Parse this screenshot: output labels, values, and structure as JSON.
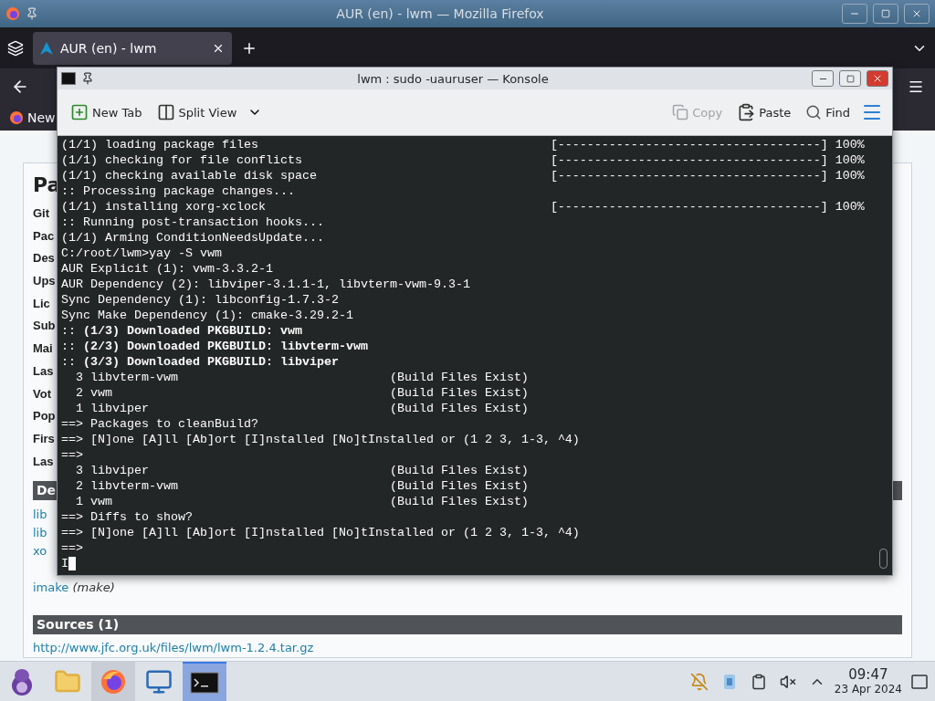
{
  "firefox": {
    "title": "AUR (en) - lwm — Mozilla Firefox",
    "tabs": [
      {
        "label": "AUR (en) - lwm",
        "selected": true
      }
    ],
    "bookmarks": [
      {
        "label": "New"
      }
    ],
    "page": {
      "heading": "Pa",
      "fields": [
        "Git",
        "Pac",
        "Des",
        "Ups",
        "Lic",
        "Sub",
        "Mai",
        "Las",
        "Vot",
        "Pop",
        "Firs",
        "Las"
      ],
      "dependencies_header": "De",
      "dependencies": [
        {
          "name": "lib"
        },
        {
          "name": "lib"
        },
        {
          "name": "xo"
        },
        {
          "name": "imake",
          "note": "(make)"
        }
      ],
      "sources_header": "Sources (1)",
      "sources": [
        "http://www.jfc.org.uk/files/lwm/lwm-1.2.4.tar.gz"
      ]
    }
  },
  "konsole": {
    "title": "lwm : sudo -uauruser — Konsole",
    "toolbar_left": [
      {
        "label": "New Tab",
        "kind": "newtab",
        "disabled": false
      },
      {
        "label": "Split View",
        "kind": "split",
        "disabled": false
      }
    ],
    "toolbar_right": [
      {
        "label": "Copy",
        "kind": "copy",
        "disabled": true
      },
      {
        "label": "Paste",
        "kind": "paste",
        "disabled": false
      },
      {
        "label": "Find",
        "kind": "find",
        "disabled": false
      }
    ],
    "lines": [
      {
        "kind": "progress",
        "text": "(1/1) loading package files",
        "bar": "[------------------------------------]",
        "percent": "100%"
      },
      {
        "kind": "progress",
        "text": "(1/1) checking for file conflicts",
        "bar": "[------------------------------------]",
        "percent": "100%"
      },
      {
        "kind": "progress",
        "text": "(1/1) checking available disk space",
        "bar": "[------------------------------------]",
        "percent": "100%"
      },
      {
        "kind": "plain",
        "text": ":: Processing package changes..."
      },
      {
        "kind": "progress",
        "text": "(1/1) installing xorg-xclock",
        "bar": "[------------------------------------]",
        "percent": "100%"
      },
      {
        "kind": "plain",
        "text": ":: Running post-transaction hooks..."
      },
      {
        "kind": "plain",
        "text": "(1/1) Arming ConditionNeedsUpdate..."
      },
      {
        "kind": "plain",
        "text": "C:/root/lwm>yay -S vwm"
      },
      {
        "kind": "plain",
        "text": "AUR Explicit (1): vwm-3.3.2-1"
      },
      {
        "kind": "plain",
        "text": "AUR Dependency (2): libviper-3.1.1-1, libvterm-vwm-9.3-1"
      },
      {
        "kind": "plain",
        "text": "Sync Dependency (1): libconfig-1.7.3-2"
      },
      {
        "kind": "plain",
        "text": "Sync Make Dependency (1): cmake-3.29.2-1"
      },
      {
        "kind": "plain",
        "text": ":: **(1/3) Downloaded PKGBUILD: vwm**"
      },
      {
        "kind": "plain",
        "text": ":: **(2/3) Downloaded PKGBUILD: libvterm-vwm**"
      },
      {
        "kind": "plain",
        "text": ":: **(3/3) Downloaded PKGBUILD: libviper**"
      },
      {
        "kind": "package",
        "text": "  3 libvterm-vwm",
        "note": "(Build Files Exist)"
      },
      {
        "kind": "package",
        "text": "  2 vwm",
        "note": "(Build Files Exist)"
      },
      {
        "kind": "package",
        "text": "  1 libviper",
        "note": "(Build Files Exist)"
      },
      {
        "kind": "plain",
        "text": "==> Packages to cleanBuild?"
      },
      {
        "kind": "plain",
        "text": "==> [N]one [A]ll [Ab]ort [I]nstalled [No]tInstalled or (1 2 3, 1-3, ^4)"
      },
      {
        "kind": "plain",
        "text": "==>"
      },
      {
        "kind": "package",
        "text": "  3 libviper",
        "note": "(Build Files Exist)"
      },
      {
        "kind": "package",
        "text": "  2 libvterm-vwm",
        "note": "(Build Files Exist)"
      },
      {
        "kind": "package",
        "text": "  1 vwm",
        "note": "(Build Files Exist)"
      },
      {
        "kind": "plain",
        "text": "==> Diffs to show?"
      },
      {
        "kind": "plain",
        "text": "==> [N]one [A]ll [Ab]ort [I]nstalled [No]tInstalled or (1 2 3, 1-3, ^4)"
      },
      {
        "kind": "plain",
        "text": "==>"
      }
    ],
    "input": "I"
  },
  "taskbar": {
    "tasks": [
      {
        "kind": "menu",
        "open": false,
        "selected": false
      },
      {
        "kind": "files",
        "open": false,
        "selected": false
      },
      {
        "kind": "firefox",
        "open": true,
        "selected": false
      },
      {
        "kind": "system",
        "open": false,
        "selected": false
      },
      {
        "kind": "terminal",
        "open": true,
        "selected": true
      }
    ],
    "time": "09:47",
    "date": "23 Apr 2024"
  }
}
